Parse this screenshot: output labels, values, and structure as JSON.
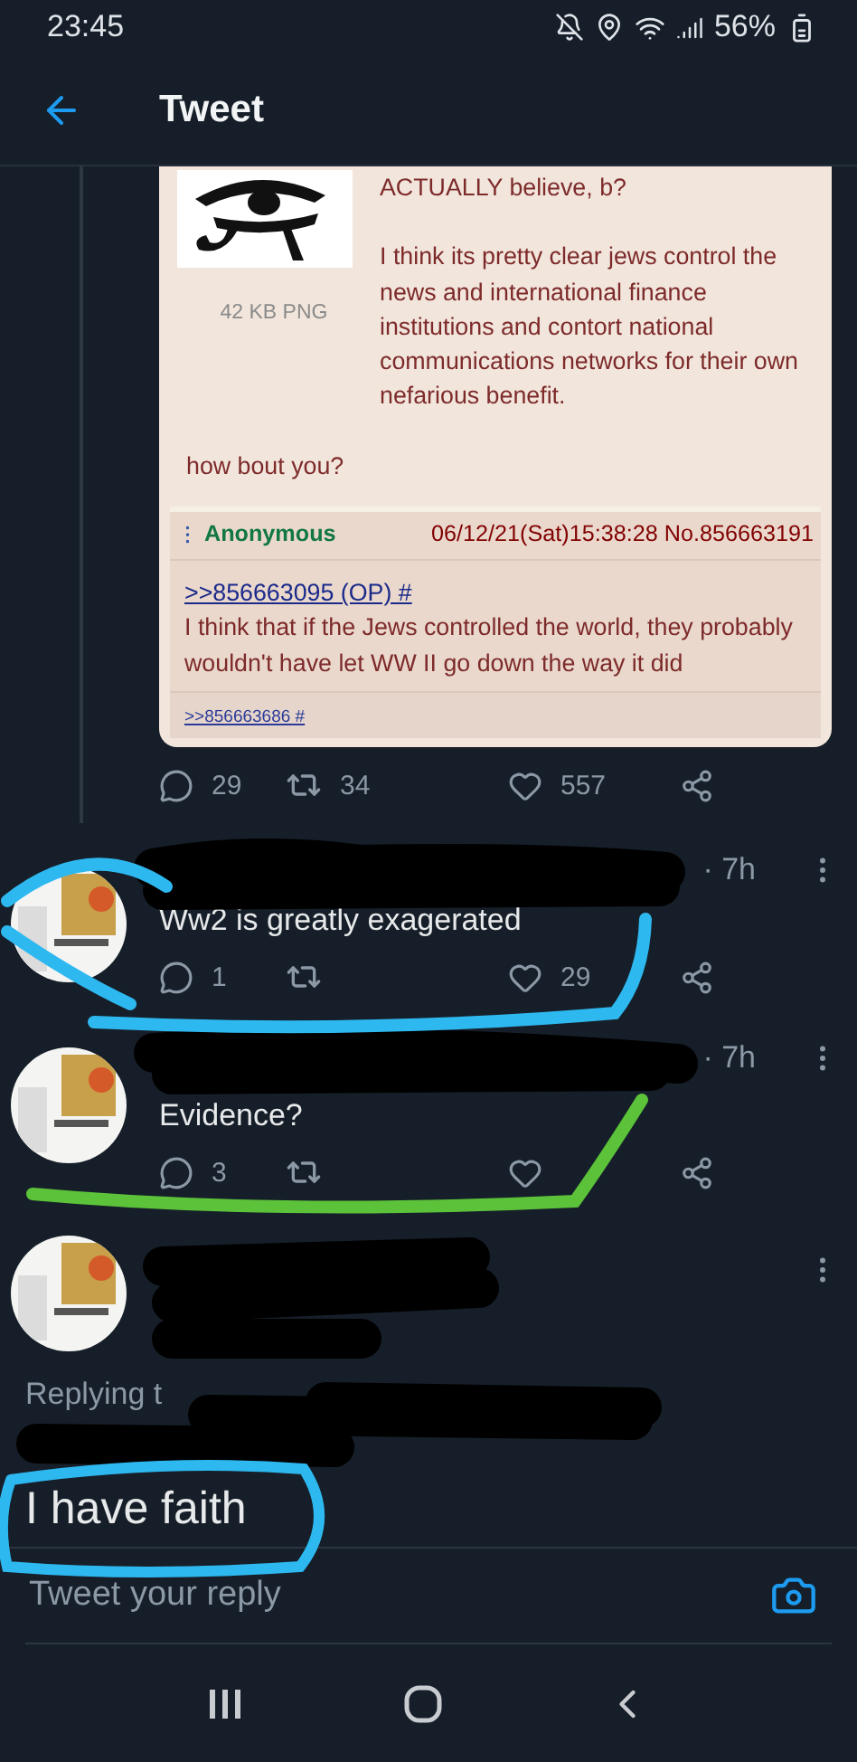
{
  "status_bar": {
    "time": "23:45",
    "battery": "56%"
  },
  "header": {
    "title": "Tweet"
  },
  "embedded_post": {
    "first_line": "ACTUALLY believe, b?",
    "file_info": "42 KB PNG",
    "body": "I think its pretty clear jews control the news and international finance institutions and contort national communications networks for their own nefarious benefit.",
    "closing": "how bout you?",
    "reply": {
      "menu_glyph": "⁝",
      "name": "Anonymous",
      "meta": "06/12/21(Sat)15:38:28 No.856663191",
      "quote_link": ">>856663095 (OP) #",
      "text": "I think that if the Jews controlled the world, they probably wouldn't have let WW II go down the way it did",
      "backlink": ">>856663686 #"
    }
  },
  "stats": {
    "replies": "29",
    "retweets": "34",
    "likes": "557"
  },
  "replies": [
    {
      "kind": "reply",
      "time": "· 7h",
      "text": "Ww2 is greatly exagerated",
      "stats": {
        "replies": "1",
        "likes": "29"
      }
    },
    {
      "kind": "reply",
      "time": "· 7h",
      "text": "Evidence?",
      "stats": {
        "replies": "3"
      }
    },
    {
      "kind": "focused",
      "replying_to": "Replying t",
      "text": "I have faith"
    }
  ],
  "composer": {
    "placeholder": "Tweet your reply"
  }
}
